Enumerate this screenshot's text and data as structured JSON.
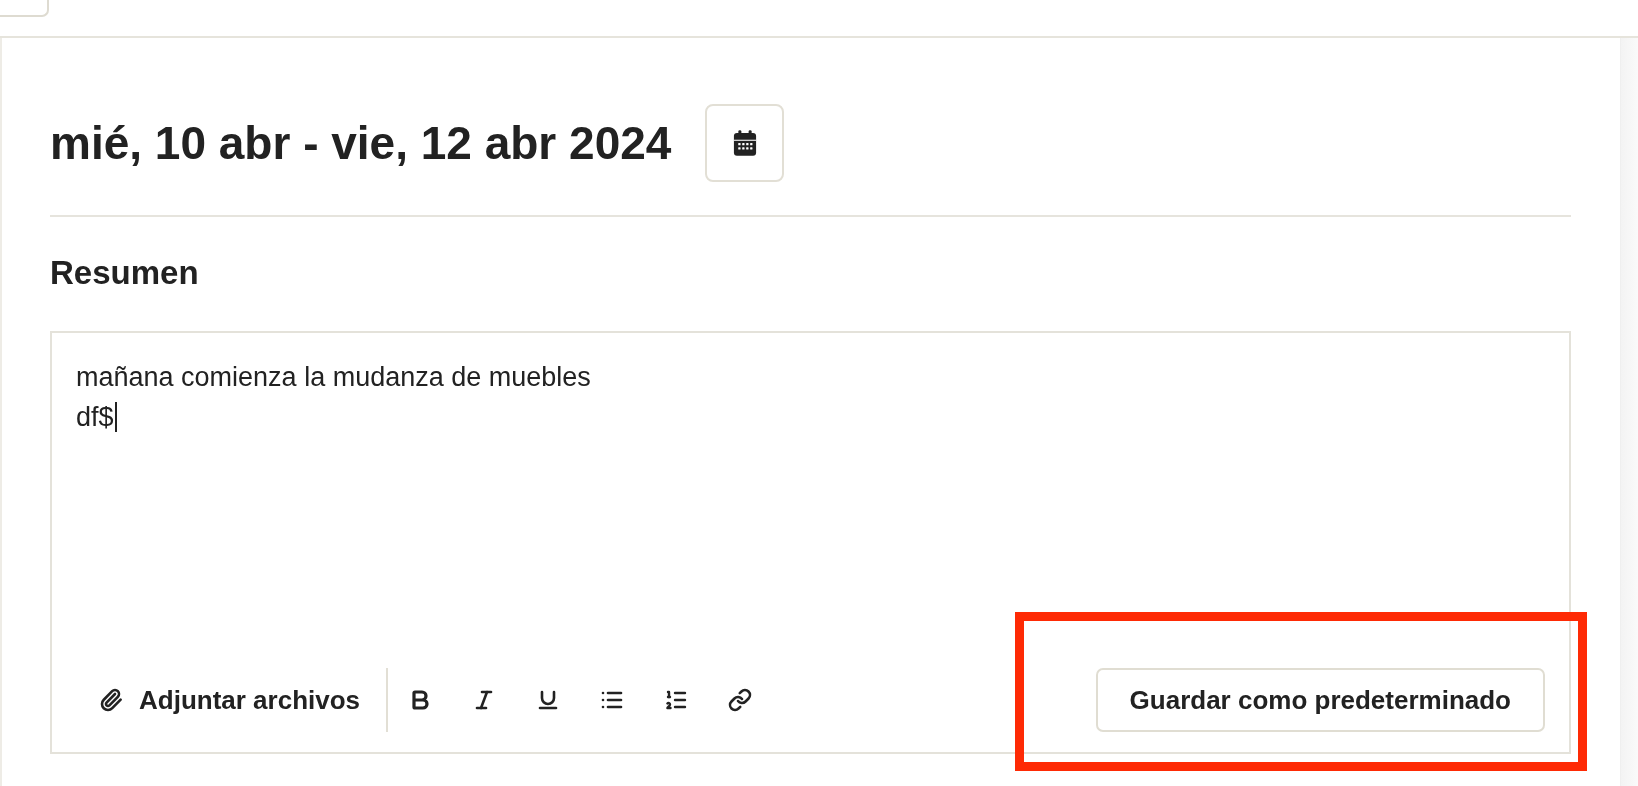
{
  "header": {
    "date_range": "mié, 10 abr - vie, 12 abr 2024"
  },
  "summary": {
    "heading": "Resumen",
    "value": "mañana comienza la mudanza de muebles\ndf$",
    "focused": true
  },
  "toolbar": {
    "attach_label": "Adjuntar archivos",
    "format_buttons": [
      {
        "kind": "bold"
      },
      {
        "kind": "italic"
      },
      {
        "kind": "underline"
      },
      {
        "kind": "bullet-list"
      },
      {
        "kind": "numbered-list"
      },
      {
        "kind": "link"
      }
    ]
  },
  "save_default_button": {
    "label": "Guardar como predeterminado",
    "highlighted": true
  }
}
